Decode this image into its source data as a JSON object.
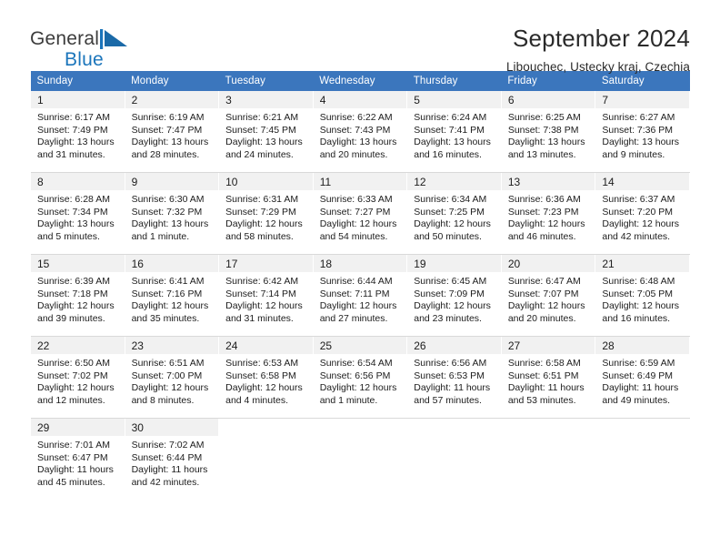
{
  "brand": {
    "name_part1": "General",
    "name_part2": "Blue",
    "logo_icon": "blue-triangle-flag-icon"
  },
  "header": {
    "title": "September 2024",
    "subtitle": "Libouchec, Ustecky kraj, Czechia"
  },
  "colors": {
    "header_blue": "#3b76bd",
    "daynum_bg": "#f1f1f1",
    "brand_blue": "#1b75bb",
    "separator": "#d9d9d9"
  },
  "weekday_headers": [
    "Sunday",
    "Monday",
    "Tuesday",
    "Wednesday",
    "Thursday",
    "Friday",
    "Saturday"
  ],
  "weeks": [
    [
      {
        "day": "1",
        "sunrise": "Sunrise: 6:17 AM",
        "sunset": "Sunset: 7:49 PM",
        "daylight1": "Daylight: 13 hours",
        "daylight2": "and 31 minutes."
      },
      {
        "day": "2",
        "sunrise": "Sunrise: 6:19 AM",
        "sunset": "Sunset: 7:47 PM",
        "daylight1": "Daylight: 13 hours",
        "daylight2": "and 28 minutes."
      },
      {
        "day": "3",
        "sunrise": "Sunrise: 6:21 AM",
        "sunset": "Sunset: 7:45 PM",
        "daylight1": "Daylight: 13 hours",
        "daylight2": "and 24 minutes."
      },
      {
        "day": "4",
        "sunrise": "Sunrise: 6:22 AM",
        "sunset": "Sunset: 7:43 PM",
        "daylight1": "Daylight: 13 hours",
        "daylight2": "and 20 minutes."
      },
      {
        "day": "5",
        "sunrise": "Sunrise: 6:24 AM",
        "sunset": "Sunset: 7:41 PM",
        "daylight1": "Daylight: 13 hours",
        "daylight2": "and 16 minutes."
      },
      {
        "day": "6",
        "sunrise": "Sunrise: 6:25 AM",
        "sunset": "Sunset: 7:38 PM",
        "daylight1": "Daylight: 13 hours",
        "daylight2": "and 13 minutes."
      },
      {
        "day": "7",
        "sunrise": "Sunrise: 6:27 AM",
        "sunset": "Sunset: 7:36 PM",
        "daylight1": "Daylight: 13 hours",
        "daylight2": "and 9 minutes."
      }
    ],
    [
      {
        "day": "8",
        "sunrise": "Sunrise: 6:28 AM",
        "sunset": "Sunset: 7:34 PM",
        "daylight1": "Daylight: 13 hours",
        "daylight2": "and 5 minutes."
      },
      {
        "day": "9",
        "sunrise": "Sunrise: 6:30 AM",
        "sunset": "Sunset: 7:32 PM",
        "daylight1": "Daylight: 13 hours",
        "daylight2": "and 1 minute."
      },
      {
        "day": "10",
        "sunrise": "Sunrise: 6:31 AM",
        "sunset": "Sunset: 7:29 PM",
        "daylight1": "Daylight: 12 hours",
        "daylight2": "and 58 minutes."
      },
      {
        "day": "11",
        "sunrise": "Sunrise: 6:33 AM",
        "sunset": "Sunset: 7:27 PM",
        "daylight1": "Daylight: 12 hours",
        "daylight2": "and 54 minutes."
      },
      {
        "day": "12",
        "sunrise": "Sunrise: 6:34 AM",
        "sunset": "Sunset: 7:25 PM",
        "daylight1": "Daylight: 12 hours",
        "daylight2": "and 50 minutes."
      },
      {
        "day": "13",
        "sunrise": "Sunrise: 6:36 AM",
        "sunset": "Sunset: 7:23 PM",
        "daylight1": "Daylight: 12 hours",
        "daylight2": "and 46 minutes."
      },
      {
        "day": "14",
        "sunrise": "Sunrise: 6:37 AM",
        "sunset": "Sunset: 7:20 PM",
        "daylight1": "Daylight: 12 hours",
        "daylight2": "and 42 minutes."
      }
    ],
    [
      {
        "day": "15",
        "sunrise": "Sunrise: 6:39 AM",
        "sunset": "Sunset: 7:18 PM",
        "daylight1": "Daylight: 12 hours",
        "daylight2": "and 39 minutes."
      },
      {
        "day": "16",
        "sunrise": "Sunrise: 6:41 AM",
        "sunset": "Sunset: 7:16 PM",
        "daylight1": "Daylight: 12 hours",
        "daylight2": "and 35 minutes."
      },
      {
        "day": "17",
        "sunrise": "Sunrise: 6:42 AM",
        "sunset": "Sunset: 7:14 PM",
        "daylight1": "Daylight: 12 hours",
        "daylight2": "and 31 minutes."
      },
      {
        "day": "18",
        "sunrise": "Sunrise: 6:44 AM",
        "sunset": "Sunset: 7:11 PM",
        "daylight1": "Daylight: 12 hours",
        "daylight2": "and 27 minutes."
      },
      {
        "day": "19",
        "sunrise": "Sunrise: 6:45 AM",
        "sunset": "Sunset: 7:09 PM",
        "daylight1": "Daylight: 12 hours",
        "daylight2": "and 23 minutes."
      },
      {
        "day": "20",
        "sunrise": "Sunrise: 6:47 AM",
        "sunset": "Sunset: 7:07 PM",
        "daylight1": "Daylight: 12 hours",
        "daylight2": "and 20 minutes."
      },
      {
        "day": "21",
        "sunrise": "Sunrise: 6:48 AM",
        "sunset": "Sunset: 7:05 PM",
        "daylight1": "Daylight: 12 hours",
        "daylight2": "and 16 minutes."
      }
    ],
    [
      {
        "day": "22",
        "sunrise": "Sunrise: 6:50 AM",
        "sunset": "Sunset: 7:02 PM",
        "daylight1": "Daylight: 12 hours",
        "daylight2": "and 12 minutes."
      },
      {
        "day": "23",
        "sunrise": "Sunrise: 6:51 AM",
        "sunset": "Sunset: 7:00 PM",
        "daylight1": "Daylight: 12 hours",
        "daylight2": "and 8 minutes."
      },
      {
        "day": "24",
        "sunrise": "Sunrise: 6:53 AM",
        "sunset": "Sunset: 6:58 PM",
        "daylight1": "Daylight: 12 hours",
        "daylight2": "and 4 minutes."
      },
      {
        "day": "25",
        "sunrise": "Sunrise: 6:54 AM",
        "sunset": "Sunset: 6:56 PM",
        "daylight1": "Daylight: 12 hours",
        "daylight2": "and 1 minute."
      },
      {
        "day": "26",
        "sunrise": "Sunrise: 6:56 AM",
        "sunset": "Sunset: 6:53 PM",
        "daylight1": "Daylight: 11 hours",
        "daylight2": "and 57 minutes."
      },
      {
        "day": "27",
        "sunrise": "Sunrise: 6:58 AM",
        "sunset": "Sunset: 6:51 PM",
        "daylight1": "Daylight: 11 hours",
        "daylight2": "and 53 minutes."
      },
      {
        "day": "28",
        "sunrise": "Sunrise: 6:59 AM",
        "sunset": "Sunset: 6:49 PM",
        "daylight1": "Daylight: 11 hours",
        "daylight2": "and 49 minutes."
      }
    ],
    [
      {
        "day": "29",
        "sunrise": "Sunrise: 7:01 AM",
        "sunset": "Sunset: 6:47 PM",
        "daylight1": "Daylight: 11 hours",
        "daylight2": "and 45 minutes."
      },
      {
        "day": "30",
        "sunrise": "Sunrise: 7:02 AM",
        "sunset": "Sunset: 6:44 PM",
        "daylight1": "Daylight: 11 hours",
        "daylight2": "and 42 minutes."
      },
      null,
      null,
      null,
      null,
      null
    ]
  ]
}
